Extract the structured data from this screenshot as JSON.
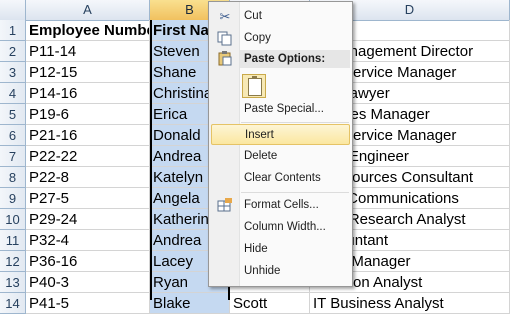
{
  "columns": [
    "A",
    "B",
    "C",
    "D"
  ],
  "header_row": {
    "employee_number": "Employee Number",
    "first_name": "First Nam",
    "last_name": "",
    "position": "on"
  },
  "rows": [
    {
      "num": "1"
    },
    {
      "num": "2",
      "a": "P11-14",
      "b": "Steven",
      "c": "",
      "d": "ct Management Director"
    },
    {
      "num": "3",
      "a": "P12-15",
      "b": "Shane",
      "c": "",
      "d": "mer Service Manager"
    },
    {
      "num": "4",
      "a": "P14-16",
      "b": "Christina",
      "c": "",
      "d": "ey / Lawyer"
    },
    {
      "num": "5",
      "a": "P19-6",
      "b": "Erica",
      "c": "",
      "d": "le Sales Manager"
    },
    {
      "num": "6",
      "a": "P21-16",
      "b": "Donald",
      "c": "",
      "d": "mer Service Manager"
    },
    {
      "num": "7",
      "a": "P22-22",
      "b": "Andrea",
      "c": "",
      "d": "work Engineer"
    },
    {
      "num": "8",
      "a": "P22-8",
      "b": "Katelyn",
      "c": "",
      "d": "n Resources Consultant"
    },
    {
      "num": "9",
      "a": "P27-5",
      "b": "Angela",
      "c": "",
      "d": "or of Communications"
    },
    {
      "num": "10",
      "a": "P29-24",
      "b": "Katherine",
      "c": "",
      "d": "tions Research Analyst"
    },
    {
      "num": "11",
      "a": "P32-4",
      "b": "Andrea",
      "c": "",
      "d": "Accountant"
    },
    {
      "num": "12",
      "a": "P36-16",
      "b": "Lacey",
      "c": "",
      "d": "gram Manager"
    },
    {
      "num": "13",
      "a": "P40-3",
      "b": "Ryan",
      "c": "",
      "d": "ensation Analyst"
    },
    {
      "num": "14",
      "a": "P41-5",
      "b": "Blake",
      "c": "Scott",
      "d": "IT Business Analyst"
    }
  ],
  "context_menu": {
    "cut": "Cut",
    "copy": "Copy",
    "paste_options_header": "Paste Options:",
    "paste_special": "Paste Special...",
    "insert": "Insert",
    "delete": "Delete",
    "clear_contents": "Clear Contents",
    "format_cells": "Format Cells...",
    "column_width": "Column Width...",
    "hide": "Hide",
    "unhide": "Unhide"
  },
  "colors": {
    "selected_column_fill": "#c5d9f1",
    "header_highlight": "#f1c15f",
    "menu_hover": "#fbe7a0"
  }
}
